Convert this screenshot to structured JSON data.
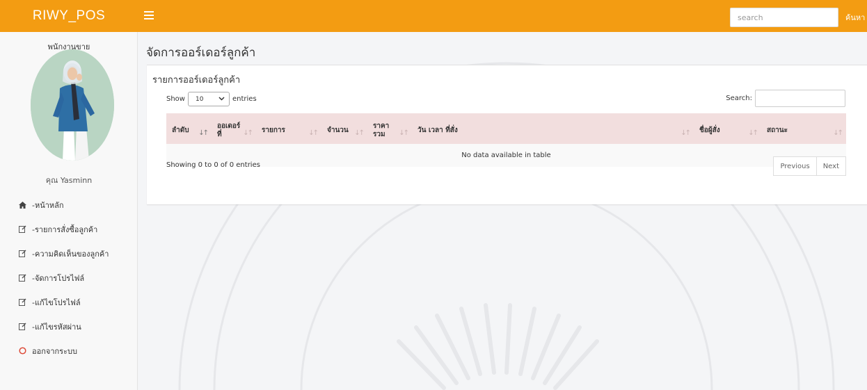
{
  "topbar": {
    "brand": "RIWY_POS",
    "menu_icon": "hamburger-icon",
    "search_placeholder": "search",
    "search_button": "ค้นหา",
    "color": "#f39c12"
  },
  "sidebar": {
    "role": "พนักงานขาย",
    "user_name": "คุณ Yasminn",
    "items": [
      {
        "label": "-หน้าหลัก",
        "icon": "home-icon"
      },
      {
        "label": "-รายการสั่งซื้อลูกค้า",
        "icon": "edit-icon"
      },
      {
        "label": "-ความคิดเห็นของลูกค้า",
        "icon": "edit-icon"
      },
      {
        "label": "-จัดการโปรไฟล์",
        "icon": "edit-icon"
      },
      {
        "label": "-แก้ไขโปรไฟล์",
        "icon": "edit-icon"
      },
      {
        "label": "-แก้ไขรหัสผ่าน",
        "icon": "edit-icon"
      },
      {
        "label": "ออกจากระบบ",
        "icon": "logout-circle-icon"
      }
    ]
  },
  "main": {
    "page_title": "จัดการออร์เดอร์ลูกค้า",
    "box_title": "รายการออร์เดอร์ลูกค้า",
    "show_label": "Show",
    "length_value": "10",
    "entries_label": "entries",
    "search_label": "Search:",
    "columns": [
      "ลำดับ",
      "ออเดอร์ ที่",
      "รายการ",
      "จำนวน",
      "ราคา รวม",
      "วัน เวลา ที่สั่ง",
      "ชื่อผู้สั่ง",
      "สถานะ"
    ],
    "empty_message": "No data available in table",
    "info": "Showing 0 to 0 of 0 entries",
    "prev_label": "Previous",
    "next_label": "Next"
  }
}
